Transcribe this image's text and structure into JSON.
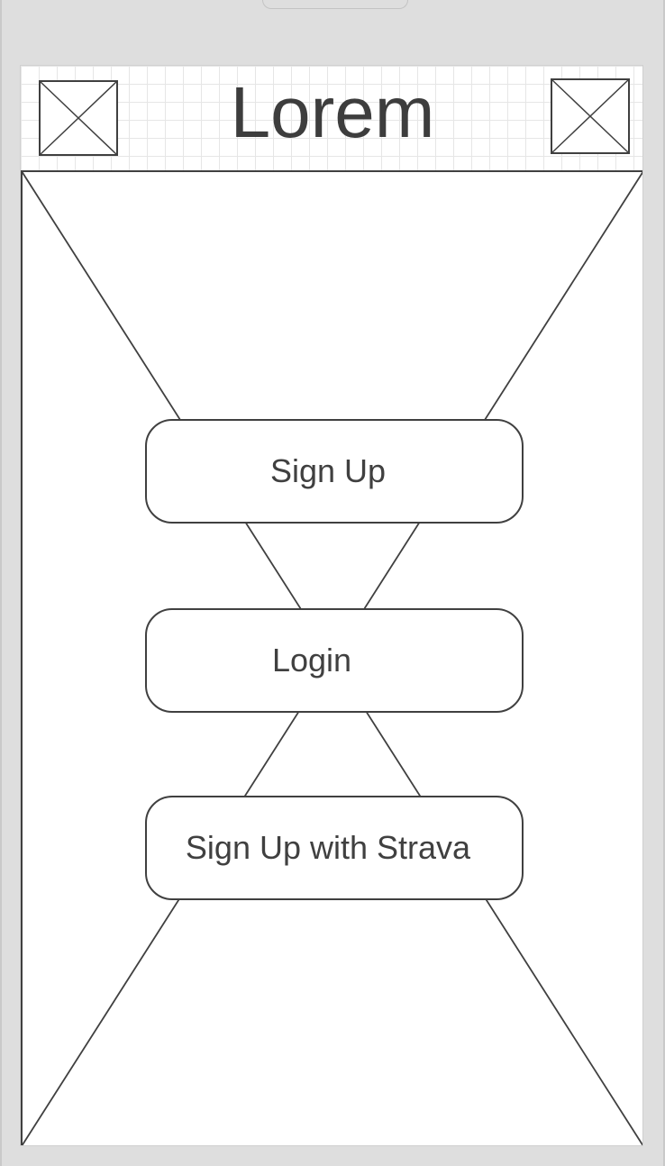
{
  "header": {
    "title": "Lorem",
    "left_icon": "image-placeholder-icon",
    "right_icon": "image-placeholder-icon"
  },
  "hero": {
    "background_icon": "image-placeholder-icon"
  },
  "actions": {
    "signup_label": "Sign Up",
    "login_label": "Login",
    "strava_label": "Sign Up with Strava"
  },
  "colors": {
    "frame": "#dedede",
    "screen": "#ffffff",
    "stroke": "#404040",
    "grid": "#e6e6e6"
  }
}
